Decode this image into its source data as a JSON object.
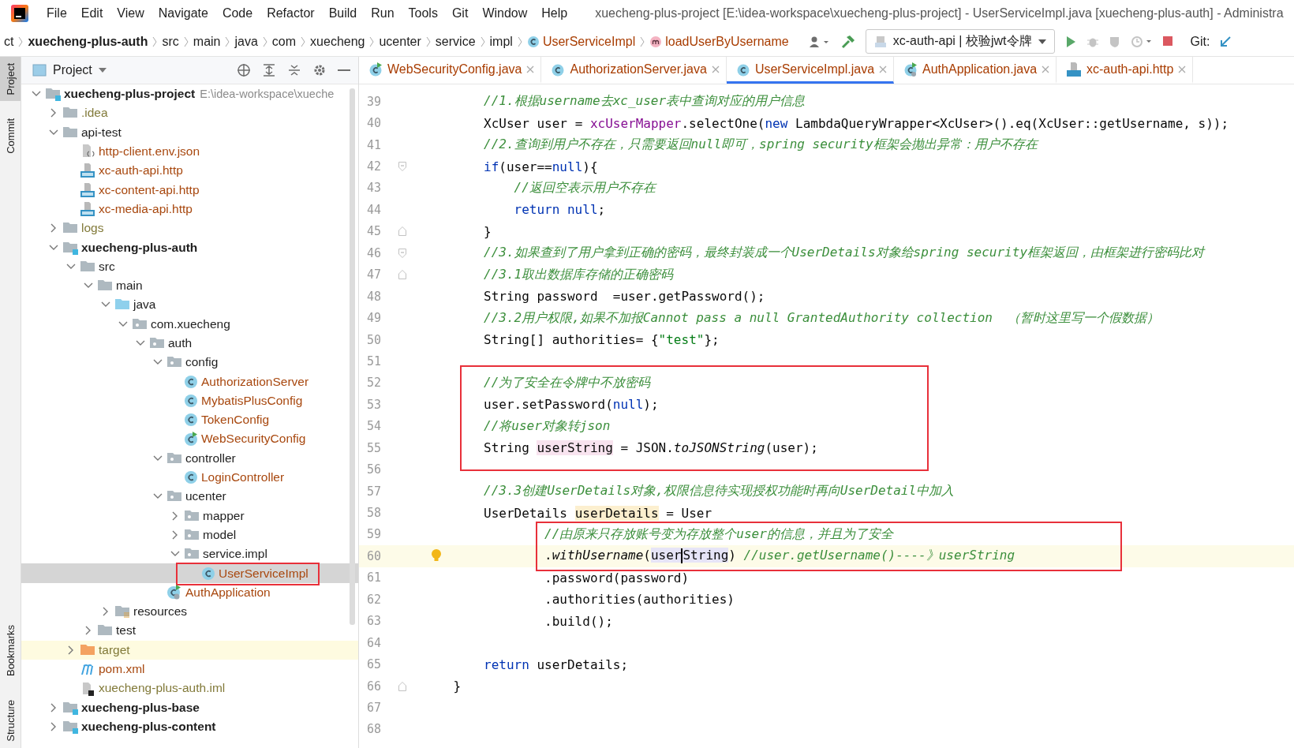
{
  "menu": {
    "items": [
      "File",
      "Edit",
      "View",
      "Navigate",
      "Code",
      "Refactor",
      "Build",
      "Run",
      "Tools",
      "Git",
      "Window",
      "Help"
    ],
    "title": "xuecheng-plus-project [E:\\idea-workspace\\xuecheng-plus-project] - UserServiceImpl.java [xuecheng-plus-auth] - Administra"
  },
  "breadcrumbs": [
    {
      "label": "ct",
      "kind": "plain"
    },
    {
      "label": "xuecheng-plus-auth",
      "kind": "module"
    },
    {
      "label": "src",
      "kind": "plain"
    },
    {
      "label": "main",
      "kind": "plain"
    },
    {
      "label": "java",
      "kind": "plain"
    },
    {
      "label": "com",
      "kind": "plain"
    },
    {
      "label": "xuecheng",
      "kind": "plain"
    },
    {
      "label": "ucenter",
      "kind": "plain"
    },
    {
      "label": "service",
      "kind": "plain"
    },
    {
      "label": "impl",
      "kind": "plain"
    },
    {
      "label": "UserServiceImpl",
      "kind": "class"
    },
    {
      "label": "loadUserByUsername",
      "kind": "method"
    }
  ],
  "toolbar": {
    "run_config": "xc-auth-api | 校验jwt令牌",
    "git_label": "Git:"
  },
  "side_strip": [
    {
      "label": "Project",
      "kind": "top",
      "selected": true
    },
    {
      "label": "Commit",
      "kind": "top",
      "selected": false
    },
    {
      "label": "Bookmarks",
      "kind": "bottom",
      "selected": false
    },
    {
      "label": "Structure",
      "kind": "bottom",
      "selected": false
    }
  ],
  "project_panel": {
    "title": "Project"
  },
  "tree": [
    {
      "name": "xuecheng-plus-project",
      "kind": "module",
      "hint": "E:\\idea-workspace\\xueche",
      "color": "#1e1e1e",
      "selected": false,
      "annotated": false,
      "expanded": true,
      "children": [
        {
          "name": ".idea",
          "kind": "folder",
          "color": "#827a3a",
          "selected": false,
          "annotated": false,
          "expanded": false
        },
        {
          "name": "api-test",
          "kind": "folder",
          "color": "#1e1e1e",
          "selected": false,
          "annotated": false,
          "expanded": true,
          "children": [
            {
              "name": "http-client.env.json",
              "kind": "json",
              "color": "#a8480f",
              "selected": false,
              "annotated": false
            },
            {
              "name": "xc-auth-api.http",
              "kind": "http",
              "color": "#a8480f",
              "selected": false,
              "annotated": false
            },
            {
              "name": "xc-content-api.http",
              "kind": "http",
              "color": "#a8480f",
              "selected": false,
              "annotated": false
            },
            {
              "name": "xc-media-api.http",
              "kind": "http",
              "color": "#a8480f",
              "selected": false,
              "annotated": false
            }
          ]
        },
        {
          "name": "logs",
          "kind": "folder",
          "color": "#827a3a",
          "selected": false,
          "annotated": false,
          "expanded": false
        },
        {
          "name": "xuecheng-plus-auth",
          "kind": "module",
          "color": "#1e1e1e",
          "selected": false,
          "annotated": false,
          "expanded": true,
          "children": [
            {
              "name": "src",
              "kind": "folder",
              "color": "#1e1e1e",
              "selected": false,
              "annotated": false,
              "expanded": true,
              "children": [
                {
                  "name": "main",
                  "kind": "folder",
                  "color": "#1e1e1e",
                  "selected": false,
                  "annotated": false,
                  "expanded": true,
                  "children": [
                    {
                      "name": "java",
                      "kind": "source",
                      "color": "#1e1e1e",
                      "selected": false,
                      "annotated": false,
                      "expanded": true,
                      "children": [
                        {
                          "name": "com.xuecheng",
                          "kind": "package",
                          "color": "#1e1e1e",
                          "selected": false,
                          "annotated": false,
                          "expanded": true,
                          "children": [
                            {
                              "name": "auth",
                              "kind": "package",
                              "color": "#1e1e1e",
                              "selected": false,
                              "annotated": false,
                              "expanded": true,
                              "children": [
                                {
                                  "name": "config",
                                  "kind": "package",
                                  "color": "#1e1e1e",
                                  "selected": false,
                                  "annotated": false,
                                  "expanded": true,
                                  "children": [
                                    {
                                      "name": "AuthorizationServer",
                                      "kind": "class",
                                      "color": "#a8480f",
                                      "selected": false,
                                      "annotated": false
                                    },
                                    {
                                      "name": "MybatisPlusConfig",
                                      "kind": "class",
                                      "color": "#a8480f",
                                      "selected": false,
                                      "annotated": false
                                    },
                                    {
                                      "name": "TokenConfig",
                                      "kind": "class",
                                      "color": "#a8480f",
                                      "selected": false,
                                      "annotated": false
                                    },
                                    {
                                      "name": "WebSecurityConfig",
                                      "kind": "class-run",
                                      "color": "#a8480f",
                                      "selected": false,
                                      "annotated": false
                                    }
                                  ]
                                },
                                {
                                  "name": "controller",
                                  "kind": "package",
                                  "color": "#1e1e1e",
                                  "selected": false,
                                  "annotated": false,
                                  "expanded": true,
                                  "children": [
                                    {
                                      "name": "LoginController",
                                      "kind": "class",
                                      "color": "#a8480f",
                                      "selected": false,
                                      "annotated": false
                                    }
                                  ]
                                },
                                {
                                  "name": "ucenter",
                                  "kind": "package",
                                  "color": "#1e1e1e",
                                  "selected": false,
                                  "annotated": false,
                                  "expanded": true,
                                  "children": [
                                    {
                                      "name": "mapper",
                                      "kind": "package",
                                      "color": "#1e1e1e",
                                      "selected": false,
                                      "annotated": false,
                                      "expanded": false
                                    },
                                    {
                                      "name": "model",
                                      "kind": "package",
                                      "color": "#1e1e1e",
                                      "selected": false,
                                      "annotated": false,
                                      "expanded": false
                                    },
                                    {
                                      "name": "service.impl",
                                      "kind": "package",
                                      "color": "#1e1e1e",
                                      "selected": false,
                                      "annotated": false,
                                      "expanded": true,
                                      "children": [
                                        {
                                          "name": "UserServiceImpl",
                                          "kind": "class",
                                          "color": "#a8480f",
                                          "selected": true,
                                          "annotated": true
                                        }
                                      ]
                                    }
                                  ]
                                },
                                {
                                  "name": "AuthApplication",
                                  "kind": "app",
                                  "color": "#a8480f",
                                  "selected": false,
                                  "annotated": false
                                }
                              ]
                            }
                          ]
                        }
                      ]
                    },
                    {
                      "name": "resources",
                      "kind": "resources",
                      "color": "#1e1e1e",
                      "selected": false,
                      "annotated": false,
                      "expanded": false
                    }
                  ]
                },
                {
                  "name": "test",
                  "kind": "folder",
                  "color": "#1e1e1e",
                  "selected": false,
                  "annotated": false,
                  "expanded": false
                }
              ]
            },
            {
              "name": "target",
              "kind": "excluded",
              "color": "#827a3a",
              "selected": false,
              "annotated": false,
              "expanded": false
            },
            {
              "name": "pom.xml",
              "kind": "maven",
              "color": "#a8480f",
              "selected": false,
              "annotated": false
            },
            {
              "name": "xuecheng-plus-auth.iml",
              "kind": "iml",
              "color": "#827a3a",
              "selected": false,
              "annotated": false
            }
          ]
        },
        {
          "name": "xuecheng-plus-base",
          "kind": "module",
          "color": "#1e1e1e",
          "selected": false,
          "annotated": false,
          "expanded": false
        },
        {
          "name": "xuecheng-plus-content",
          "kind": "module",
          "color": "#1e1e1e",
          "selected": false,
          "annotated": false,
          "expanded": false
        }
      ]
    }
  ],
  "tabs": [
    {
      "label": "WebSecurityConfig.java",
      "kind": "class-run",
      "selected": false
    },
    {
      "label": "AuthorizationServer.java",
      "kind": "class",
      "selected": false
    },
    {
      "label": "UserServiceImpl.java",
      "kind": "class",
      "selected": true
    },
    {
      "label": "AuthApplication.java",
      "kind": "app",
      "selected": false
    },
    {
      "label": "xc-auth-api.http",
      "kind": "http",
      "selected": false
    }
  ],
  "editor": {
    "blocks": [
      {
        "kind": "plain",
        "lines": [
          {
            "number": "39",
            "kind": "body",
            "tokens": [
              {
                "t": "//1.根据username去xc_user表中查询对应的用户信息",
                "kind": "comment"
              }
            ]
          },
          {
            "number": "40",
            "kind": "body",
            "tokens": [
              {
                "t": "XcUser user = ",
                "kind": "plain"
              },
              {
                "t": "xcUserMapper",
                "kind": "field"
              },
              {
                "t": ".selectOne(",
                "kind": "plain"
              },
              {
                "t": "new",
                "kind": "keyword"
              },
              {
                "t": " LambdaQueryWrapper<XcUser>().eq(XcUser::getUsername, s));",
                "kind": "plain"
              }
            ]
          },
          {
            "number": "41",
            "kind": "body",
            "tokens": [
              {
                "t": "//2.查询到用户不存在，只需要返回null即可，spring security框架会抛出异常：用户不存在",
                "kind": "comment"
              }
            ]
          },
          {
            "number": "42",
            "kind": "body-fold-start",
            "tokens": [
              {
                "t": "if",
                "kind": "keyword"
              },
              {
                "t": "(user==",
                "kind": "plain"
              },
              {
                "t": "null",
                "kind": "keyword"
              },
              {
                "t": "){",
                "kind": "plain"
              }
            ]
          },
          {
            "number": "43",
            "kind": "nested",
            "tokens": [
              {
                "t": "//返回空表示用户不存在",
                "kind": "comment"
              }
            ]
          },
          {
            "number": "44",
            "kind": "nested",
            "tokens": [
              {
                "t": "return",
                "kind": "keyword"
              },
              {
                "t": " null",
                "kind": "keyword"
              },
              {
                "t": ";",
                "kind": "plain"
              }
            ]
          },
          {
            "number": "45",
            "kind": "body-fold-end",
            "tokens": [
              {
                "t": "}",
                "kind": "plain"
              }
            ]
          },
          {
            "number": "46",
            "kind": "body-fold-start",
            "tokens": [
              {
                "t": "//3.如果查到了用户拿到正确的密码，最终封装成一个UserDetails对象给spring security框架返回，由框架进行密码比对",
                "kind": "comment"
              }
            ]
          },
          {
            "number": "47",
            "kind": "body-fold-end",
            "tokens": [
              {
                "t": "//3.1取出数据库存储的正确密码",
                "kind": "comment"
              }
            ]
          },
          {
            "number": "48",
            "kind": "body",
            "tokens": [
              {
                "t": "String password  =user.getPassword();",
                "kind": "plain"
              }
            ]
          },
          {
            "number": "49",
            "kind": "body",
            "tokens": [
              {
                "t": "//3.2用户权限,如果不加报Cannot pass a null GrantedAuthority collection  （暂时这里写一个假数据）",
                "kind": "comment"
              }
            ]
          },
          {
            "number": "50",
            "kind": "body",
            "tokens": [
              {
                "t": "String[] authorities= {",
                "kind": "plain"
              },
              {
                "t": "\"test\"",
                "kind": "string"
              },
              {
                "t": "};",
                "kind": "plain"
              }
            ]
          },
          {
            "number": "51",
            "kind": "empty"
          }
        ]
      },
      {
        "kind": "outer-frame",
        "lines": [
          {
            "number": "52",
            "kind": "body",
            "tokens": [
              {
                "t": "//为了安全在令牌中不放密码",
                "kind": "comment"
              }
            ]
          },
          {
            "number": "53",
            "kind": "body",
            "tokens": [
              {
                "t": "user.setPassword(",
                "kind": "plain"
              },
              {
                "t": "null",
                "kind": "keyword"
              },
              {
                "t": ");",
                "kind": "plain"
              }
            ]
          },
          {
            "number": "54",
            "kind": "body",
            "tokens": [
              {
                "t": "//将user对象转json",
                "kind": "comment"
              }
            ]
          },
          {
            "number": "55",
            "kind": "body",
            "tokens": [
              {
                "t": "String ",
                "kind": "plain"
              },
              {
                "t": "userString",
                "kind": "write-usage"
              },
              {
                "t": " = JSON.",
                "kind": "plain"
              },
              {
                "t": "toJSONString",
                "kind": "italic"
              },
              {
                "t": "(user);",
                "kind": "plain"
              }
            ]
          }
        ]
      },
      {
        "kind": "plain",
        "lines": [
          {
            "number": "56",
            "kind": "empty"
          },
          {
            "number": "57",
            "kind": "body",
            "tokens": [
              {
                "t": "//3.3创建UserDetails对象,权限信息待实现授权功能时再向UserDetail中加入",
                "kind": "comment"
              }
            ]
          },
          {
            "number": "58",
            "kind": "body",
            "tokens": [
              {
                "t": "UserDetails ",
                "kind": "plain"
              },
              {
                "t": "userDetails",
                "kind": "declaration"
              },
              {
                "t": " = User",
                "kind": "plain"
              }
            ]
          }
        ]
      },
      {
        "kind": "inner-frame",
        "lines": [
          {
            "number": "59",
            "kind": "chain",
            "tokens": [
              {
                "t": "//由原来只存放账号变为存放整个user的信息，并且为了安全",
                "kind": "comment"
              }
            ]
          },
          {
            "number": "60",
            "kind": "chain-current",
            "tokens": [
              {
                "t": ".",
                "kind": "plain"
              },
              {
                "t": "withUsername",
                "kind": "italic"
              },
              {
                "t": "(",
                "kind": "plain"
              },
              {
                "t": "user",
                "kind": "read-usage-caret"
              },
              {
                "t": "String",
                "kind": "read-usage"
              },
              {
                "t": ") ",
                "kind": "plain"
              },
              {
                "t": "//user.getUsername()----》userString",
                "kind": "comment"
              }
            ]
          }
        ]
      },
      {
        "kind": "plain",
        "lines": [
          {
            "number": "61",
            "kind": "chain",
            "tokens": [
              {
                "t": ".password(password)",
                "kind": "plain"
              }
            ]
          },
          {
            "number": "62",
            "kind": "chain",
            "tokens": [
              {
                "t": ".authorities(authorities)",
                "kind": "plain"
              }
            ]
          },
          {
            "number": "63",
            "kind": "chain",
            "tokens": [
              {
                "t": ".build();",
                "kind": "plain"
              }
            ]
          },
          {
            "number": "64",
            "kind": "empty"
          },
          {
            "number": "65",
            "kind": "body",
            "tokens": [
              {
                "t": "return",
                "kind": "keyword"
              },
              {
                "t": " userDetails;",
                "kind": "plain"
              }
            ]
          },
          {
            "number": "66",
            "kind": "class-fold-end",
            "tokens": [
              {
                "t": "}",
                "kind": "plain"
              }
            ]
          },
          {
            "number": "67",
            "kind": "empty"
          },
          {
            "number": "68",
            "kind": "empty"
          }
        ]
      }
    ]
  }
}
